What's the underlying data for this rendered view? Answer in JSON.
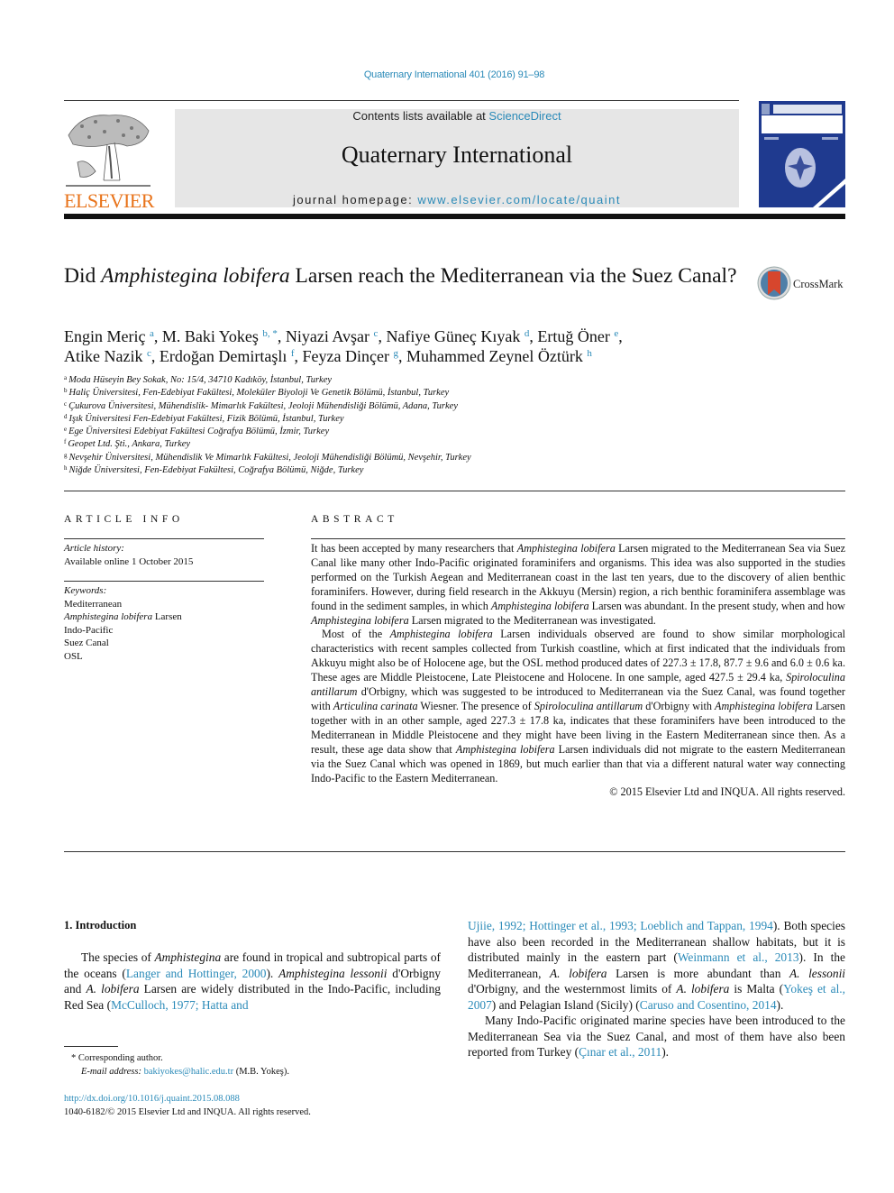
{
  "citation": "Quaternary International 401 (2016) 91–98",
  "publisher_logo": {
    "icon": "elsevier-tree-icon",
    "wordmark": "ELSEVIER"
  },
  "banner": {
    "contents_prefix": "Contents lists available at ",
    "contents_link": "ScienceDirect",
    "journal_title": "Quaternary International",
    "homepage_prefix": "journal homepage: ",
    "homepage_link": "www.elsevier.com/locate/quaint"
  },
  "cover": {
    "icon": "journal-cover-thumbnail"
  },
  "colors": {
    "link": "#2a8ab8",
    "elsevier_orange": "#e8731a",
    "cover_blue": "#1f3a8f",
    "banner_gray": "#e6e6e6"
  },
  "article": {
    "title_pre": "Did ",
    "title_italic": "Amphistegina lobifera",
    "title_post": " Larsen reach the Mediterranean via the Suez Canal?",
    "crossmark_label": "CrossMark",
    "authors": [
      {
        "name": "Engin Meriç",
        "sup": "a",
        "sep": ", "
      },
      {
        "name": "M. Baki Yokeş",
        "sup": "b, *",
        "sep": ", "
      },
      {
        "name": "Niyazi Avşar",
        "sup": "c",
        "sep": ", "
      },
      {
        "name": "Nafiye Güneç Kıyak",
        "sup": "d",
        "sep": ", "
      },
      {
        "name": "Ertuğ Öner",
        "sup": "e",
        "sep": ","
      },
      {
        "name": "Atike Nazik",
        "sup": "c",
        "sep": ", "
      },
      {
        "name": "Erdoğan Demirtaşlı",
        "sup": "f",
        "sep": ", "
      },
      {
        "name": "Feyza Dinçer",
        "sup": "g",
        "sep": ", "
      },
      {
        "name": "Muhammed Zeynel Öztürk",
        "sup": "h",
        "sep": ""
      }
    ],
    "affiliations": [
      {
        "key": "a",
        "text": "Moda Hüseyin Bey Sokak, No: 15/4, 34710 Kadıköy, İstanbul, Turkey"
      },
      {
        "key": "b",
        "text": "Haliç Üniversitesi, Fen-Edebiyat Fakültesi, Moleküler Biyoloji Ve Genetik Bölümü, İstanbul, Turkey"
      },
      {
        "key": "c",
        "text": "Çukurova Üniversitesi, Mühendislik- Mimarlık Fakültesi, Jeoloji Mühendisliği Bölümü, Adana, Turkey"
      },
      {
        "key": "d",
        "text": "Işık Üniversitesi Fen-Edebiyat Fakültesi, Fizik Bölümü, İstanbul, Turkey"
      },
      {
        "key": "e",
        "text": "Ege Üniversitesi Edebiyat Fakültesi Coğrafya Bölümü, İzmir, Turkey"
      },
      {
        "key": "f",
        "text": "Geopet Ltd. Şti., Ankara, Turkey"
      },
      {
        "key": "g",
        "text": "Nevşehir Üniversitesi, Mühendislik Ve Mimarlık Fakültesi, Jeoloji Mühendisliği Bölümü, Nevşehir, Turkey"
      },
      {
        "key": "h",
        "text": "Niğde Üniversitesi, Fen-Edebiyat Fakültesi, Coğrafya Bölümü, Niğde, Turkey"
      }
    ]
  },
  "article_info": {
    "heading": "ARTICLE INFO",
    "history_label": "Article history:",
    "history_value": "Available online 1 October 2015",
    "keywords_label": "Keywords:",
    "keywords": [
      {
        "italic": "",
        "text": "Mediterranean"
      },
      {
        "italic": "Amphistegina lobifera",
        "text": " Larsen"
      },
      {
        "italic": "",
        "text": "Indo-Pacific"
      },
      {
        "italic": "",
        "text": "Suez Canal"
      },
      {
        "italic": "",
        "text": "OSL"
      }
    ]
  },
  "abstract": {
    "heading": "ABSTRACT",
    "paragraphs": [
      [
        {
          "t": "It has been accepted by many researchers that "
        },
        {
          "t": "Amphistegina lobifera",
          "i": true
        },
        {
          "t": " Larsen migrated to the Mediterranean Sea via Suez Canal like many other Indo-Pacific originated foraminifers and organisms. This idea was also supported in the studies performed on the Turkish Aegean and Mediterranean coast in the last ten years, due to the discovery of alien benthic foraminifers. However, during field research in the Akkuyu (Mersin) region, a rich benthic foraminifera assemblage was found in the sediment samples, in which "
        },
        {
          "t": "Amphistegina lobifera",
          "i": true
        },
        {
          "t": " Larsen was abundant. In the present study, when and how "
        },
        {
          "t": "Amphistegina lobifera",
          "i": true
        },
        {
          "t": " Larsen migrated to the Mediterranean was investigated."
        }
      ],
      [
        {
          "t": "Most of the "
        },
        {
          "t": "Amphistegina lobifera",
          "i": true
        },
        {
          "t": " Larsen individuals observed are found to show similar morphological characteristics with recent samples collected from Turkish coastline, which at first indicated that the individuals from Akkuyu might also be of Holocene age, but the OSL method produced dates of 227.3 ± 17.8, 87.7 ± 9.6 and 6.0 ± 0.6 ka. These ages are Middle Pleistocene, Late Pleistocene and Holocene. In one sample, aged 427.5 ± 29.4 ka, "
        },
        {
          "t": "Spiroloculina antillarum",
          "i": true
        },
        {
          "t": " d'Orbigny, which was suggested to be introduced to Mediterranean via the Suez Canal, was found together with "
        },
        {
          "t": "Articulina carinata",
          "i": true
        },
        {
          "t": " Wiesner. The presence of "
        },
        {
          "t": "Spiroloculina antillarum",
          "i": true
        },
        {
          "t": " d'Orbigny with "
        },
        {
          "t": "Amphistegina lobifera",
          "i": true
        },
        {
          "t": " Larsen together with in an other sample, aged 227.3 ± 17.8 ka, indicates that these foraminifers have been introduced to the Mediterranean in Middle Pleistocene and they might have been living in the Eastern Mediterranean since then. As a result, these age data show that "
        },
        {
          "t": "Amphistegina lobifera",
          "i": true
        },
        {
          "t": " Larsen individuals did not migrate to the eastern Mediterranean via the Suez Canal which was opened in 1869, but much earlier than that via a different natural water way connecting Indo-Pacific to the Eastern Mediterranean."
        }
      ]
    ],
    "copyright": "© 2015 Elsevier Ltd and INQUA. All rights reserved."
  },
  "introduction": {
    "heading": "1.  Introduction",
    "left_paragraphs": [
      [
        {
          "t": "The species of "
        },
        {
          "t": "Amphistegina",
          "i": true
        },
        {
          "t": " are found in tropical and subtropical parts of the oceans ("
        },
        {
          "t": "Langer and Hottinger, 2000",
          "l": true
        },
        {
          "t": "). "
        },
        {
          "t": "Amphistegina lessonii",
          "i": true
        },
        {
          "t": " d'Orbigny and "
        },
        {
          "t": "A. lobifera",
          "i": true
        },
        {
          "t": " Larsen are widely distributed in the Indo-Pacific, including Red Sea ("
        },
        {
          "t": "McCulloch, 1977; Hatta and",
          "l": true
        }
      ]
    ],
    "right_paragraphs": [
      [
        {
          "t": "Ujiie, 1992; Hottinger et al., 1993; Loeblich and Tappan, 1994",
          "l": true
        },
        {
          "t": "). Both species have also been recorded in the Mediterranean shallow habitats, but it is distributed mainly in the eastern part ("
        },
        {
          "t": "Weinmann et al., 2013",
          "l": true
        },
        {
          "t": "). In the Mediterranean, "
        },
        {
          "t": "A. lobifera",
          "i": true
        },
        {
          "t": " Larsen is more abundant than "
        },
        {
          "t": "A. lessonii",
          "i": true
        },
        {
          "t": " d'Orbigny, and the westernmost limits of "
        },
        {
          "t": "A. lobifera",
          "i": true
        },
        {
          "t": " is Malta ("
        },
        {
          "t": "Yokeş et al., 2007",
          "l": true
        },
        {
          "t": ") and Pelagian Island (Sicily) ("
        },
        {
          "t": "Caruso and Cosentino, 2014",
          "l": true
        },
        {
          "t": ")."
        }
      ],
      [
        {
          "t": "Many Indo-Pacific originated marine species have been introduced to the Mediterranean Sea via the Suez Canal, and most of them have also been reported from Turkey ("
        },
        {
          "t": "Çınar et al., 2011",
          "l": true
        },
        {
          "t": ")."
        }
      ]
    ]
  },
  "footnotes": {
    "corresponding_mark": "*",
    "corresponding_text": "Corresponding author.",
    "email_label": "E-mail address: ",
    "email": "bakiyokes@halic.edu.tr",
    "email_suffix": " (M.B. Yokeş).",
    "doi": "http://dx.doi.org/10.1016/j.quaint.2015.08.088",
    "issn_copyright": "1040-6182/© 2015 Elsevier Ltd and INQUA. All rights reserved."
  }
}
